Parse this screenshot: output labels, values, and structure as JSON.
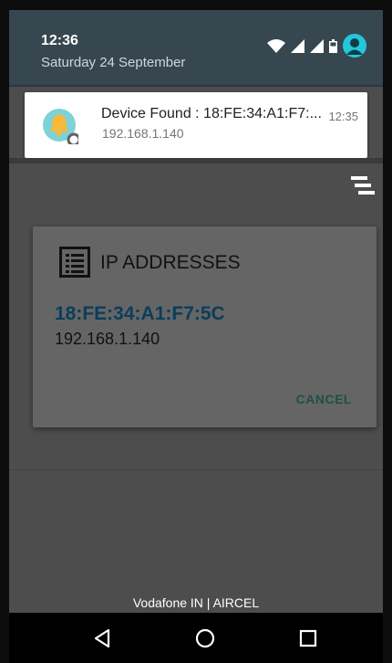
{
  "status_bar": {
    "time": "12:36",
    "date": "Saturday 24 September"
  },
  "notification": {
    "title": "Device Found : 18:FE:34:A1:F7:...",
    "time": "12:35",
    "text": "192.168.1.140",
    "icon": "bell-icon"
  },
  "dialog": {
    "title": "IP ADDRESSES",
    "mac": "18:FE:34:A1:F7:5C",
    "ip": "192.168.1.140",
    "cancel_label": "CANCEL"
  },
  "footer": {
    "carrier": "Vodafone IN | AIRCEL"
  },
  "colors": {
    "shade": "#37474f",
    "accent": "#26c6da",
    "dialog_bg": "#656565",
    "mac_text": "#0b3d5c",
    "cancel_text": "#1f4f4a"
  },
  "navbar": {
    "buttons": [
      "back-icon",
      "home-icon",
      "recents-icon"
    ]
  }
}
